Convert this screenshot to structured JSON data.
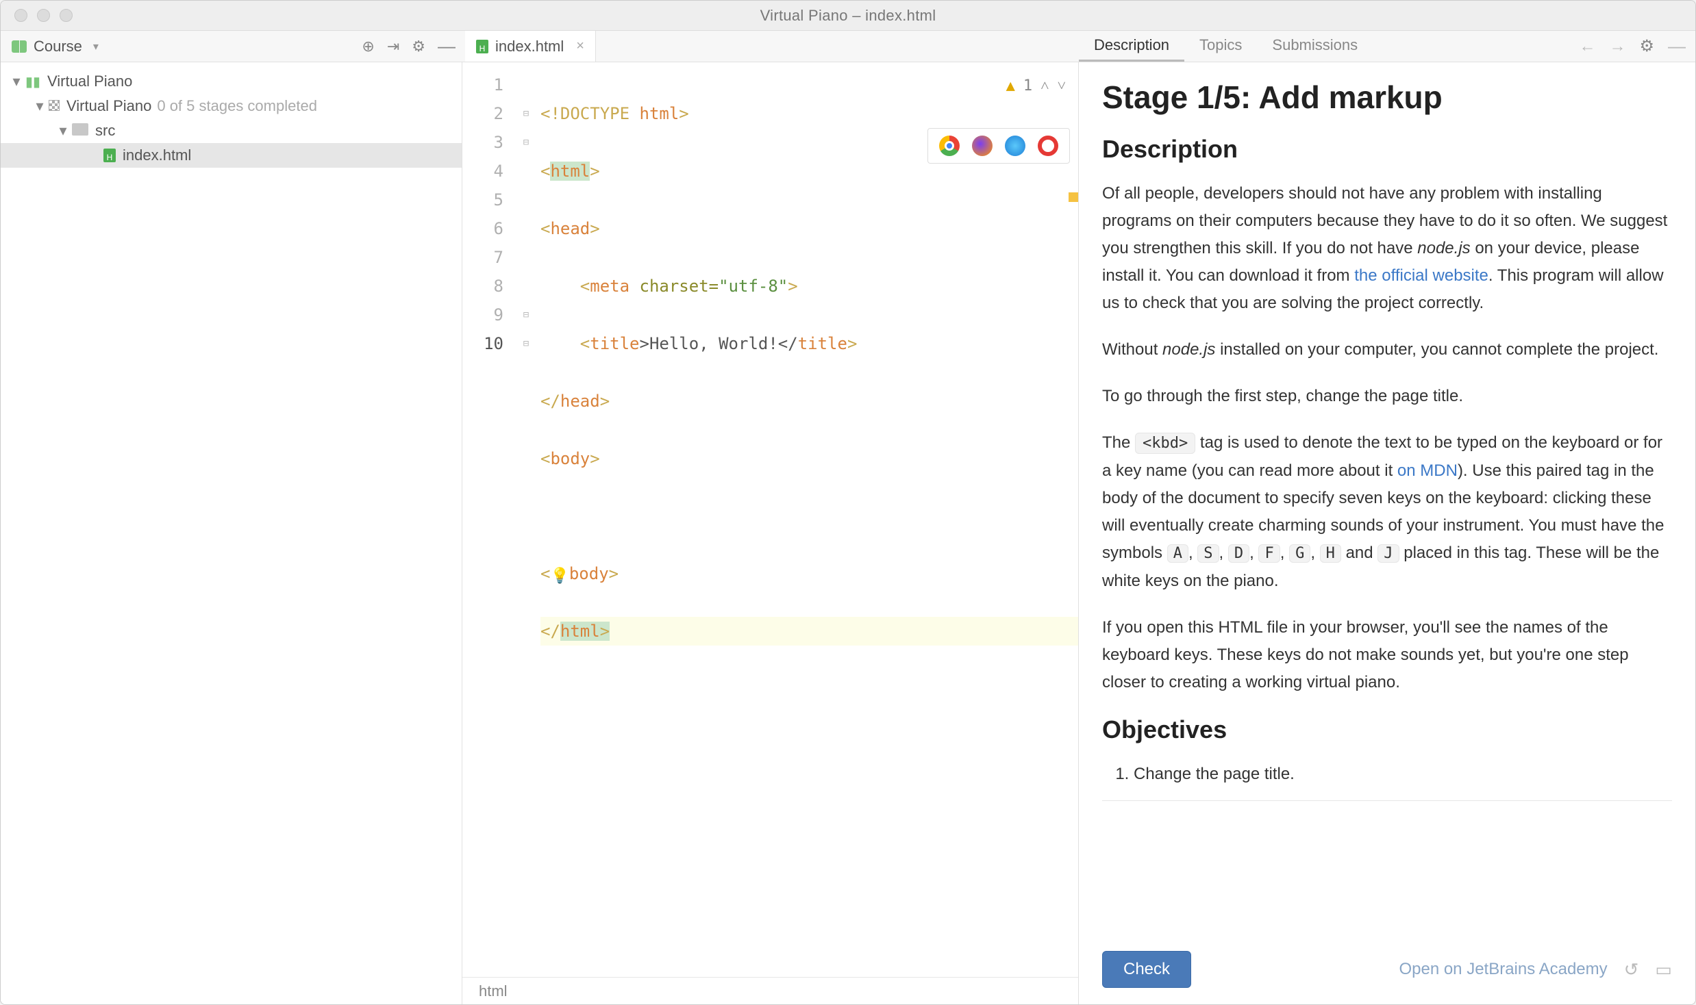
{
  "window": {
    "title": "Virtual Piano – index.html"
  },
  "toolbar": {
    "course_label": "Course",
    "tab_file": "index.html"
  },
  "right_tabs": {
    "description": "Description",
    "topics": "Topics",
    "submissions": "Submissions"
  },
  "tree": {
    "project": "Virtual Piano",
    "module": "Virtual Piano",
    "stages_suffix": "0 of 5 stages completed",
    "src": "src",
    "file": "index.html"
  },
  "editor": {
    "warn_count": "1",
    "breadcrumb": "html",
    "lines": {
      "l1a": "<!DOCTYPE ",
      "l1b": "html",
      "l1c": ">",
      "l2a": "<",
      "l2b": "html",
      "l2c": ">",
      "l3a": "<",
      "l3b": "head",
      "l3c": ">",
      "l4a": "    <",
      "l4b": "meta ",
      "l4c": "charset=",
      "l4d": "\"utf-8\"",
      "l4e": ">",
      "l5a": "    <",
      "l5b": "title",
      "l5c": ">Hello, World!</",
      "l5d": "title",
      "l5e": ">",
      "l6a": "</",
      "l6b": "head",
      "l6c": ">",
      "l7a": "<",
      "l7b": "body",
      "l7c": ">",
      "l9a": "<",
      "l9b": "body",
      "l9c": ">",
      "l10a": "</",
      "l10b": "html",
      "l10c": ">"
    },
    "line_numbers": [
      "1",
      "2",
      "3",
      "4",
      "5",
      "6",
      "7",
      "8",
      "9",
      "10"
    ]
  },
  "panel": {
    "title": "Stage 1/5: Add markup",
    "h_desc": "Description",
    "p1_a": "Of all people, developers should not have any problem with installing programs on their computers because they have to do it so often. We suggest you strengthen this skill. If you do not have ",
    "p1_em": "node.js",
    "p1_b": " on your device, please install it. You can download it from ",
    "p1_link": "the official website",
    "p1_c": ". This program will allow us to check that you are solving the project correctly.",
    "p2_a": "Without ",
    "p2_em": "node.js",
    "p2_b": " installed on your computer, you cannot complete the project.",
    "p3": "To go through the first step, change the page title.",
    "p4_a": "The ",
    "p4_code": "<kbd>",
    "p4_b": " tag is used to denote the text to be typed on the keyboard or for a key name (you can read more about it ",
    "p4_link": "on MDN",
    "p4_c": "). Use this paired tag in the body of the document to specify seven keys on the keyboard: clicking these will eventually create charming sounds of your instrument. You must have the symbols ",
    "kA": "A",
    "kS": "S",
    "kD": "D",
    "kF": "F",
    "kG": "G",
    "kH": "H",
    "kJ": "J",
    "comma": ", ",
    "p4_and": " and ",
    "p4_d": " placed in this tag. These will be the white keys on the piano.",
    "p5": "If you open this HTML file in your browser, you'll see the names of the keyboard keys. These keys do not make sounds yet, but you're one step closer to creating a working virtual piano.",
    "h_obj": "Objectives",
    "obj1": "Change the page title.",
    "check": "Check",
    "open_academy": "Open on JetBrains Academy"
  }
}
